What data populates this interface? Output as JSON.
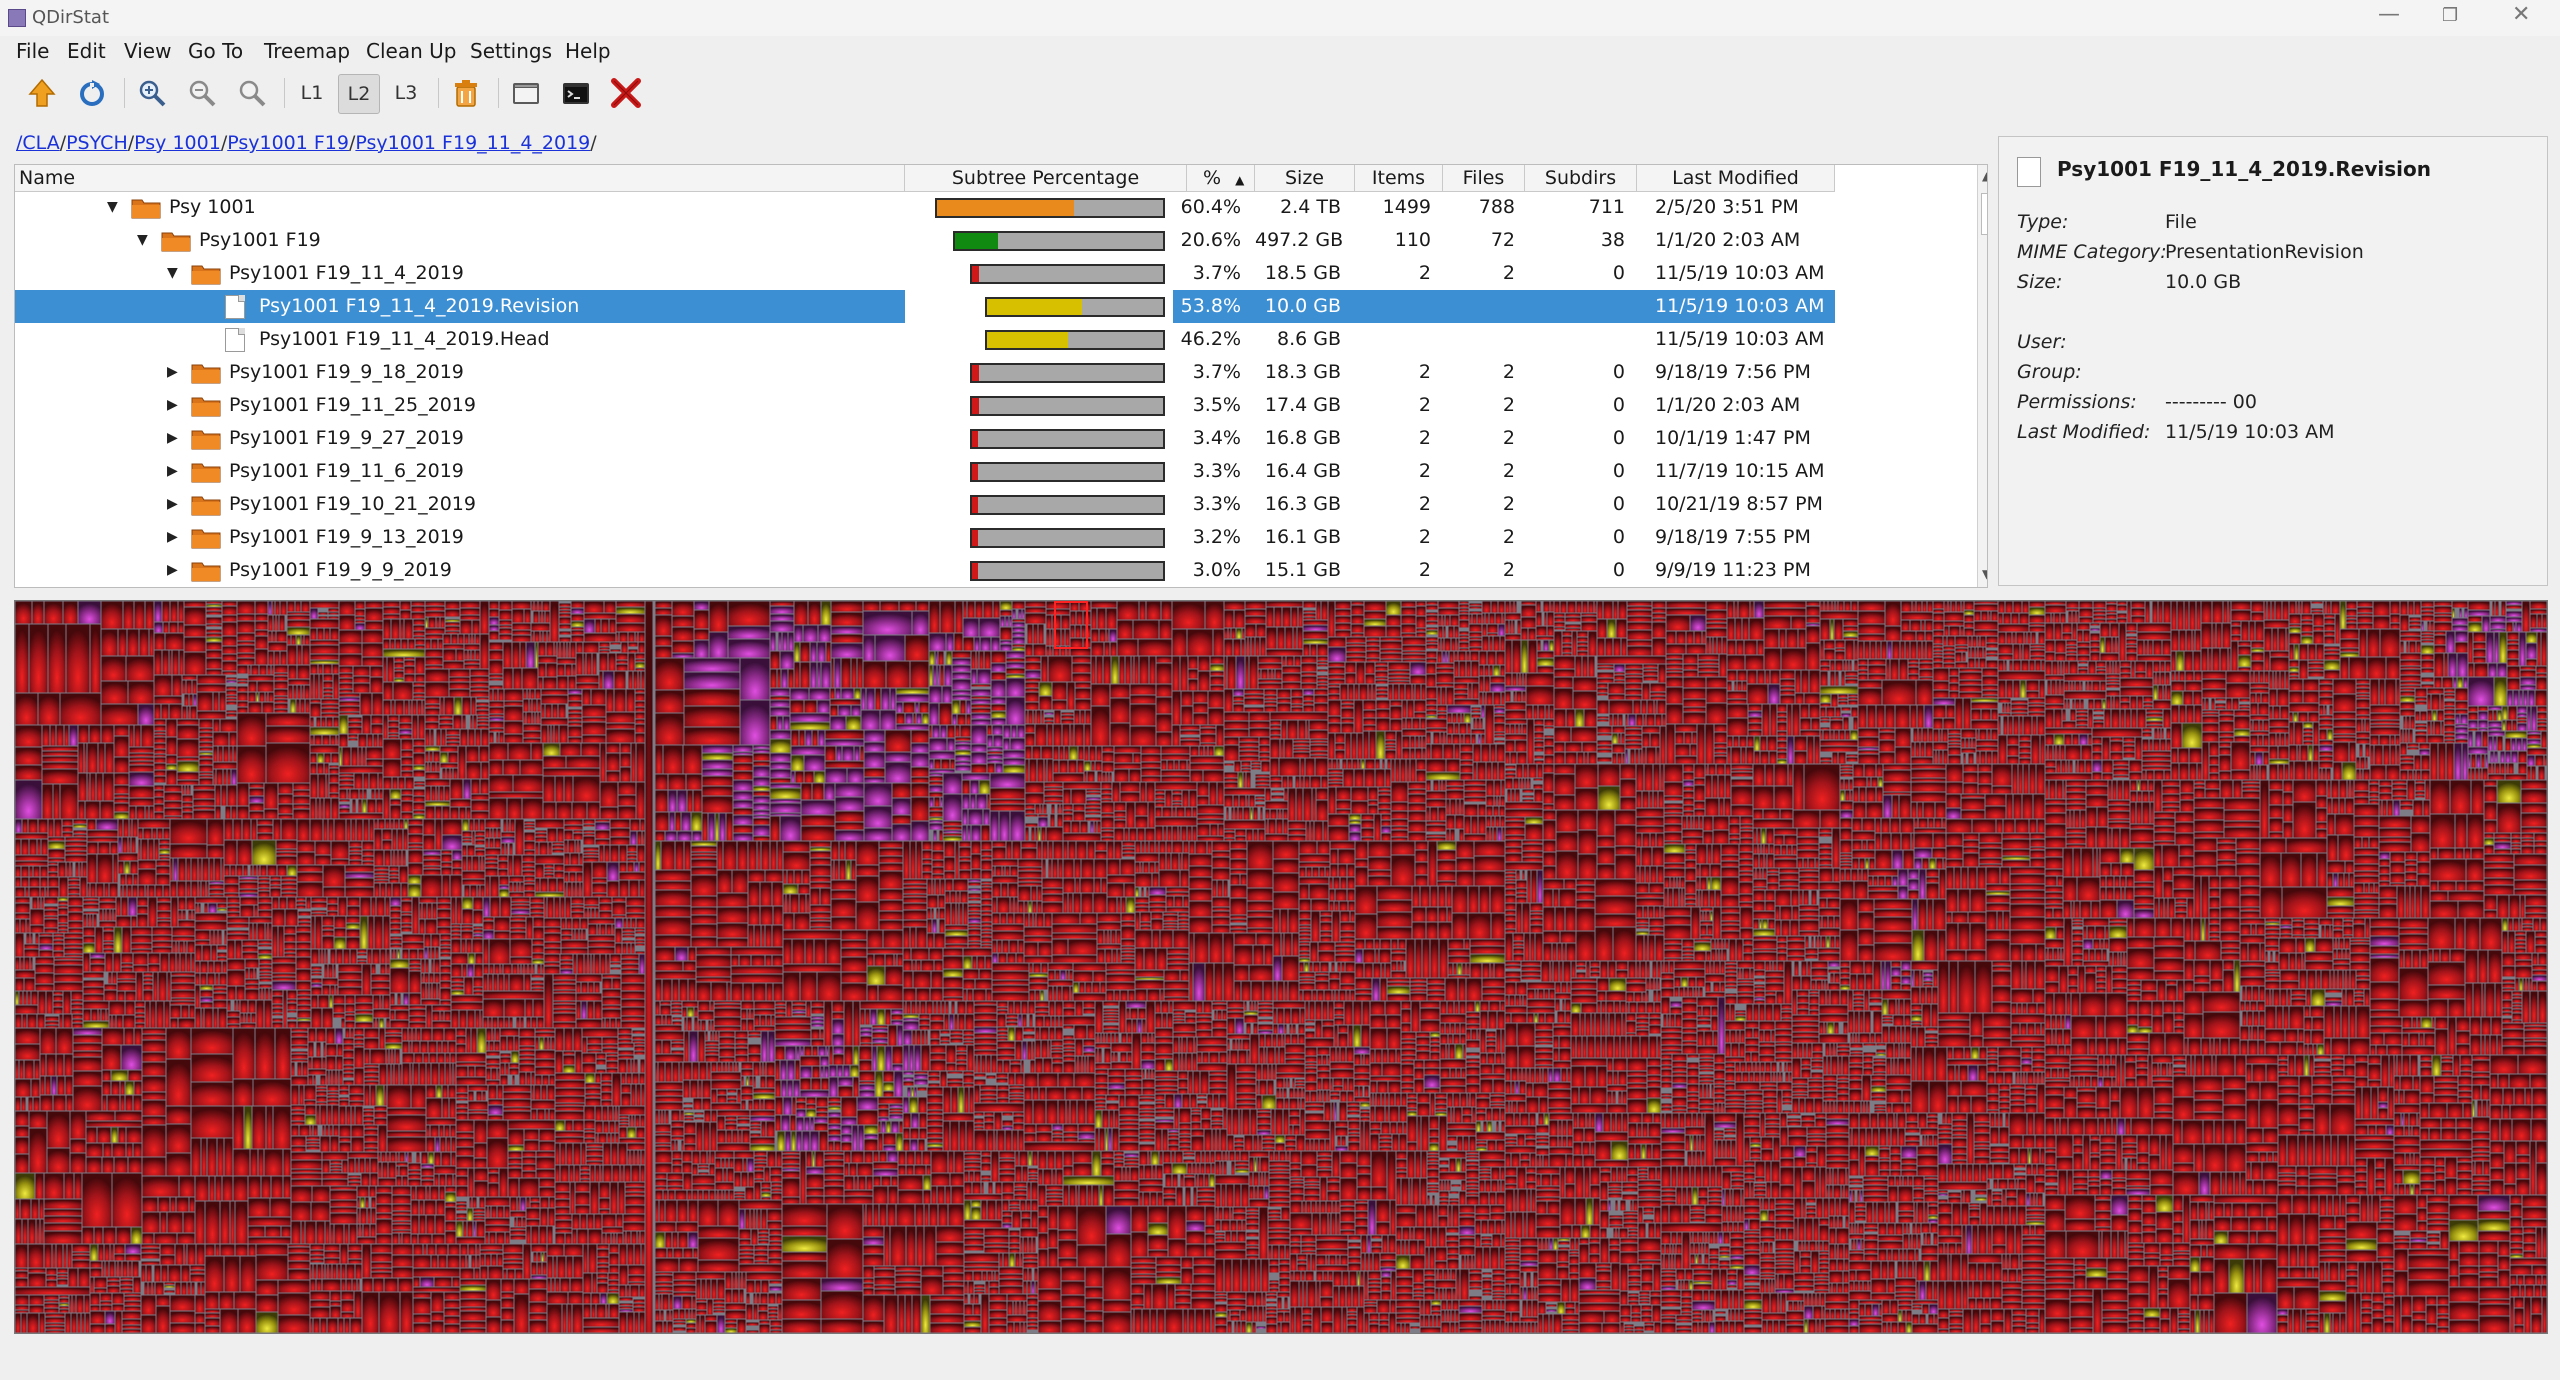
{
  "window": {
    "title": "QDirStat",
    "controls": [
      "—",
      "❐",
      "✕"
    ]
  },
  "menu": [
    "File",
    "Edit",
    "View",
    "Go To",
    "Treemap",
    "Clean Up",
    "Settings",
    "Help"
  ],
  "toolbar": {
    "levels": [
      "L1",
      "L2",
      "L3"
    ],
    "active_level": "L2",
    "icons": [
      "go-up-icon",
      "refresh-icon",
      "zoom-in-icon",
      "zoom-out-icon",
      "zoom-reset-icon",
      "level-1",
      "level-2",
      "level-3",
      "trash-icon",
      "file-manager-icon",
      "terminal-icon",
      "delete-icon"
    ]
  },
  "breadcrumb": [
    "/CLA",
    "PSYCH",
    "Psy 1001",
    "Psy1001 F19",
    "Psy1001 F19_11_4_2019"
  ],
  "tree": {
    "columns": [
      "Name",
      "Subtree Percentage",
      "%",
      "Size",
      "Items",
      "Files",
      "Subdirs",
      "Last Modified"
    ],
    "rows": [
      {
        "name": "Psy 1001",
        "type": "dir",
        "expanded": true,
        "pct_text": "60.4%",
        "size": "2.4 TB",
        "items": "1499",
        "files": "788",
        "subdirs": "711",
        "modified": "2/5/20 3:51 PM",
        "fill": 0.604,
        "color": "#e88b1c"
      },
      {
        "name": "Psy1001 F19",
        "type": "dir",
        "expanded": true,
        "pct_text": "20.6%",
        "size": "497.2 GB",
        "items": "110",
        "files": "72",
        "subdirs": "38",
        "modified": "1/1/20 2:03 AM",
        "fill": 0.206,
        "color": "#118a11"
      },
      {
        "name": "Psy1001 F19_11_4_2019",
        "type": "dir",
        "expanded": true,
        "pct_text": "3.7%",
        "size": "18.5 GB",
        "items": "2",
        "files": "2",
        "subdirs": "0",
        "modified": "11/5/19 10:03 AM",
        "fill": 0.037,
        "color": "#d01818"
      },
      {
        "name": "Psy1001 F19_11_4_2019.Revision",
        "type": "file",
        "selected": true,
        "pct_text": "53.8%",
        "size": "10.0 GB",
        "items": "",
        "files": "",
        "subdirs": "",
        "modified": "11/5/19 10:03 AM",
        "fill": 0.538,
        "color": "#d6c000"
      },
      {
        "name": "Psy1001 F19_11_4_2019.Head",
        "type": "file",
        "pct_text": "46.2%",
        "size": "8.6 GB",
        "items": "",
        "files": "",
        "subdirs": "",
        "modified": "11/5/19 10:03 AM",
        "fill": 0.462,
        "color": "#d6c000"
      },
      {
        "name": "Psy1001 F19_9_18_2019",
        "type": "dir",
        "pct_text": "3.7%",
        "size": "18.3 GB",
        "items": "2",
        "files": "2",
        "subdirs": "0",
        "modified": "9/18/19 7:56 PM",
        "fill": 0.037,
        "color": "#d01818"
      },
      {
        "name": "Psy1001 F19_11_25_2019",
        "type": "dir",
        "pct_text": "3.5%",
        "size": "17.4 GB",
        "items": "2",
        "files": "2",
        "subdirs": "0",
        "modified": "1/1/20 2:03 AM",
        "fill": 0.035,
        "color": "#d01818"
      },
      {
        "name": "Psy1001 F19_9_27_2019",
        "type": "dir",
        "pct_text": "3.4%",
        "size": "16.8 GB",
        "items": "2",
        "files": "2",
        "subdirs": "0",
        "modified": "10/1/19 1:47 PM",
        "fill": 0.034,
        "color": "#d01818"
      },
      {
        "name": "Psy1001 F19_11_6_2019",
        "type": "dir",
        "pct_text": "3.3%",
        "size": "16.4 GB",
        "items": "2",
        "files": "2",
        "subdirs": "0",
        "modified": "11/7/19 10:15 AM",
        "fill": 0.033,
        "color": "#d01818"
      },
      {
        "name": "Psy1001 F19_10_21_2019",
        "type": "dir",
        "pct_text": "3.3%",
        "size": "16.3 GB",
        "items": "2",
        "files": "2",
        "subdirs": "0",
        "modified": "10/21/19 8:57 PM",
        "fill": 0.033,
        "color": "#d01818"
      },
      {
        "name": "Psy1001 F19_9_13_2019",
        "type": "dir",
        "pct_text": "3.2%",
        "size": "16.1 GB",
        "items": "2",
        "files": "2",
        "subdirs": "0",
        "modified": "9/18/19 7:55 PM",
        "fill": 0.032,
        "color": "#d01818"
      },
      {
        "name": "Psy1001 F19_9_9_2019",
        "type": "dir",
        "pct_text": "3.0%",
        "size": "15.1 GB",
        "items": "2",
        "files": "2",
        "subdirs": "0",
        "modified": "9/9/19 11:23 PM",
        "fill": 0.03,
        "color": "#d01818"
      }
    ]
  },
  "details": {
    "title": "Psy1001 F19_11_4_2019.Revision",
    "fields": [
      {
        "label": "Type:",
        "value": "File"
      },
      {
        "label": "MIME Category:",
        "value": "PresentationRevision"
      },
      {
        "label": "Size:",
        "value": "10.0 GB"
      },
      {
        "label": "User:",
        "value": ""
      },
      {
        "label": "Group:",
        "value": ""
      },
      {
        "label": "Permissions:",
        "value": "---------  00"
      },
      {
        "label": "Last Modified:",
        "value": "11/5/19 10:03 AM"
      }
    ]
  },
  "treemap": {
    "colors": {
      "background": "#7d7d88",
      "tile": "#a0141a",
      "highlight": "#ff2222",
      "purple": "#b23aa8",
      "yellow": "#c8c21a"
    }
  }
}
